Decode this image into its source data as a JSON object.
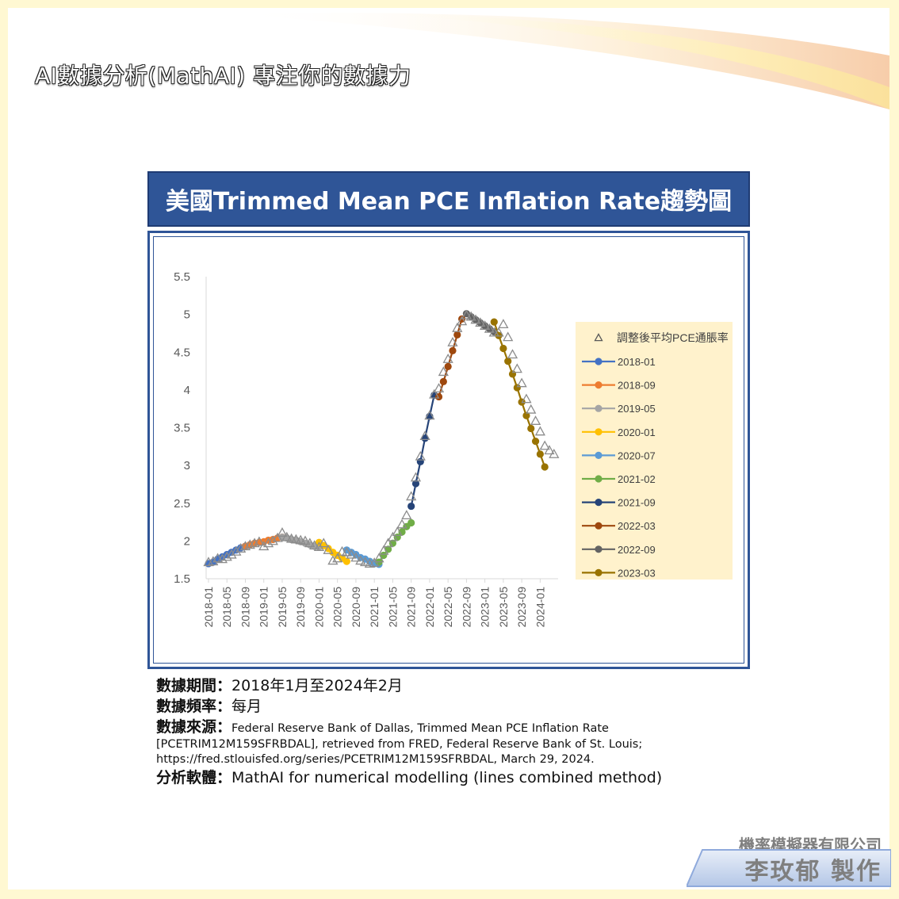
{
  "header": {
    "title": "AI數據分析(MathAI) 專注你的數據力"
  },
  "banner": {
    "title": "美國Trimmed Mean PCE Inflation Rate趨勢圖"
  },
  "meta": {
    "period_label": "數據期間：",
    "period_value": "2018年1月至2024年2月",
    "freq_label": "數據頻率：",
    "freq_value": "每月",
    "source_label": "數據來源：",
    "source_line1": "Federal Reserve Bank of Dallas, Trimmed Mean PCE Inflation Rate",
    "source_line2": "[PCETRIM12M159SFRBDAL], retrieved from FRED, Federal Reserve Bank of St. Louis;",
    "source_line3": "https://fred.stlouisfed.org/series/PCETRIM12M159SFRBDAL, March 29, 2024.",
    "software_label": "分析軟體：",
    "software_value": "MathAI for numerical modelling (lines combined method)"
  },
  "footer": {
    "company": "機率模擬器有限公司",
    "author": "李玫郁 製作"
  },
  "colors": {
    "banner": "#2f5597",
    "legend_bg": "#fff2cc",
    "triangle": "#8c8c8c"
  },
  "chart_data": {
    "type": "line",
    "yticks": [
      "5.5",
      "5",
      "4.5",
      "4",
      "3.5",
      "3",
      "2.5",
      "2",
      "1.5"
    ],
    "ylim": [
      1.5,
      5.5
    ],
    "xticks": [
      "2018-01",
      "2018-05",
      "2018-09",
      "2019-01",
      "2019-05",
      "2019-09",
      "2020-01",
      "2020-05",
      "2020-09",
      "2021-01",
      "2021-05",
      "2021-09",
      "2022-01",
      "2022-05",
      "2022-09",
      "2023-01",
      "2023-05",
      "2023-09",
      "2024-01"
    ],
    "start_month": "2018-01",
    "observed": {
      "name": "調整後平均PCE通脹率",
      "marker": "triangle",
      "values": [
        1.72,
        1.73,
        1.77,
        1.76,
        1.79,
        1.82,
        1.86,
        1.9,
        1.93,
        1.95,
        1.97,
        1.99,
        1.93,
        1.97,
        2.0,
        2.04,
        2.11,
        2.05,
        2.03,
        2.02,
        2.01,
        2.0,
        1.97,
        1.94,
        1.92,
        1.97,
        1.88,
        1.74,
        1.77,
        1.86,
        1.85,
        1.82,
        1.78,
        1.74,
        1.72,
        1.7,
        1.71,
        1.77,
        1.87,
        1.97,
        2.05,
        2.12,
        2.22,
        2.34,
        2.59,
        2.84,
        3.12,
        3.39,
        3.66,
        3.94,
        4.02,
        4.24,
        4.41,
        4.63,
        4.82,
        4.91,
        4.99,
        4.97,
        4.93,
        4.89,
        4.85,
        4.81,
        4.76,
        4.76,
        4.87,
        4.7,
        4.47,
        4.28,
        4.09,
        3.88,
        3.74,
        3.59,
        3.45,
        3.26,
        3.2,
        3.15
      ]
    },
    "series": [
      {
        "name": "2018-01",
        "color": "#4472c4",
        "start": 0,
        "values": [
          1.7,
          1.72,
          1.76,
          1.79,
          1.82,
          1.85,
          1.88,
          1.91,
          1.93
        ]
      },
      {
        "name": "2018-09",
        "color": "#ed7d31",
        "start": 8,
        "values": [
          1.93,
          1.95,
          1.97,
          1.98,
          1.99,
          2.01,
          2.02,
          2.04,
          2.05
        ]
      },
      {
        "name": "2019-05",
        "color": "#a5a5a5",
        "start": 16,
        "values": [
          2.05,
          2.04,
          2.02,
          2.01,
          1.99,
          1.97,
          1.95,
          1.93,
          1.92
        ]
      },
      {
        "name": "2020-01",
        "color": "#ffc000",
        "start": 24,
        "values": [
          1.98,
          1.94,
          1.9,
          1.85,
          1.81,
          1.77,
          1.73
        ]
      },
      {
        "name": "2020-07",
        "color": "#5b9bd5",
        "start": 30,
        "values": [
          1.88,
          1.85,
          1.82,
          1.78,
          1.76,
          1.73,
          1.7,
          1.69
        ]
      },
      {
        "name": "2021-02",
        "color": "#70ad47",
        "start": 37,
        "values": [
          1.72,
          1.81,
          1.89,
          1.97,
          2.05,
          2.12,
          2.19,
          2.24
        ]
      },
      {
        "name": "2021-09",
        "color": "#264478",
        "start": 44,
        "values": [
          2.46,
          2.76,
          3.05,
          3.36,
          3.65,
          3.93
        ]
      },
      {
        "name": "2022-03",
        "color": "#9e480e",
        "start": 50,
        "values": [
          3.91,
          4.11,
          4.31,
          4.52,
          4.73,
          4.94
        ]
      },
      {
        "name": "2022-09",
        "color": "#636363",
        "start": 56,
        "values": [
          5.01,
          4.97,
          4.93,
          4.89,
          4.85,
          4.81,
          4.77
        ]
      },
      {
        "name": "2023-03",
        "color": "#997300",
        "start": 62,
        "values": [
          4.9,
          4.72,
          4.55,
          4.38,
          4.21,
          4.03,
          3.84,
          3.66,
          3.49,
          3.32,
          3.15,
          2.98
        ]
      }
    ],
    "legend_position": "right"
  }
}
